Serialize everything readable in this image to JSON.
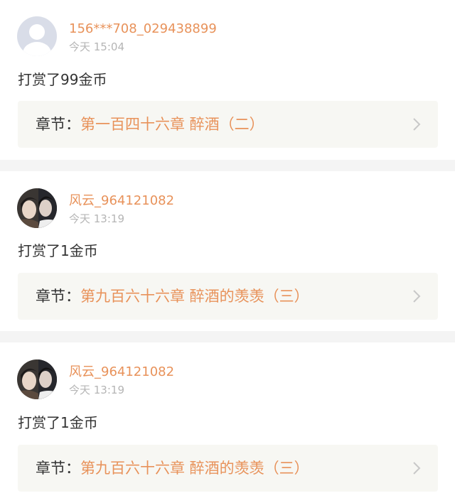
{
  "colors": {
    "accent": "#e8925a",
    "text": "#333333",
    "muted": "#b5b5b5",
    "chapter_bg": "#f7f7f3",
    "divider": "#f4f4f4",
    "chevron": "#c8c8c8"
  },
  "entries": [
    {
      "avatar": "default-user-avatar",
      "username": "156***708_029438899",
      "time": "今天 15:04",
      "reward": "打赏了99金币",
      "chapter_label": "章节：",
      "chapter_title": "第一百四十六章 醉酒（二）"
    },
    {
      "avatar": "photo-avatar",
      "username": "风云_964121082",
      "time": "今天 13:19",
      "reward": "打赏了1金币",
      "chapter_label": "章节：",
      "chapter_title": "第九百六十六章 醉酒的羡羡（三）"
    },
    {
      "avatar": "photo-avatar",
      "username": "风云_964121082",
      "time": "今天 13:19",
      "reward": "打赏了1金币",
      "chapter_label": "章节：",
      "chapter_title": "第九百六十六章 醉酒的羡羡（三）"
    }
  ]
}
